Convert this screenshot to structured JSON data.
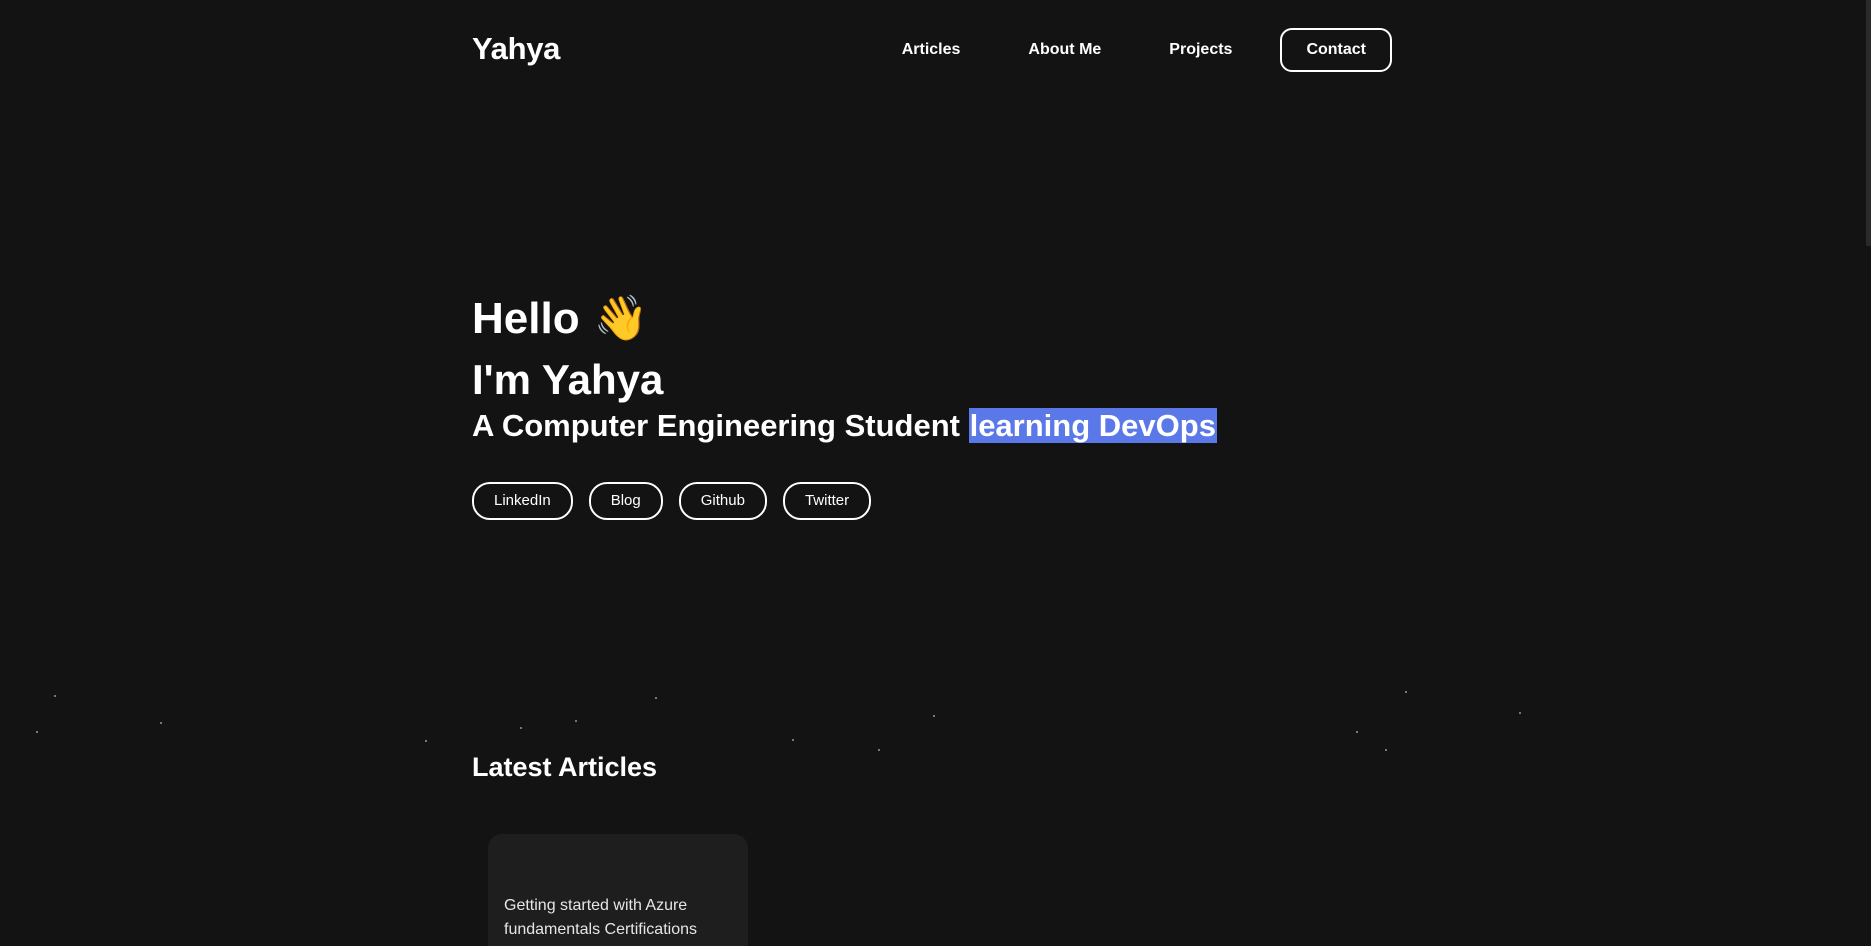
{
  "header": {
    "logo": "Yahya",
    "nav": [
      "Articles",
      "About Me",
      "Projects"
    ],
    "contact_label": "Contact"
  },
  "hero": {
    "greeting": "Hello",
    "wave_emoji": "👋",
    "intro": "I'm Yahya",
    "tagline_prefix": "A Computer Engineering Student ",
    "tagline_highlight": "learning DevOps",
    "socials": [
      "LinkedIn",
      "Blog",
      "Github",
      "Twitter"
    ]
  },
  "articles": {
    "heading": "Latest Articles",
    "items": [
      {
        "title": "Getting started with Azure fundamentals Certifications"
      }
    ]
  },
  "colors": {
    "background": "#131313",
    "highlight": "#5a78e8",
    "card": "#1e1e1e",
    "text": "#ffffff"
  }
}
